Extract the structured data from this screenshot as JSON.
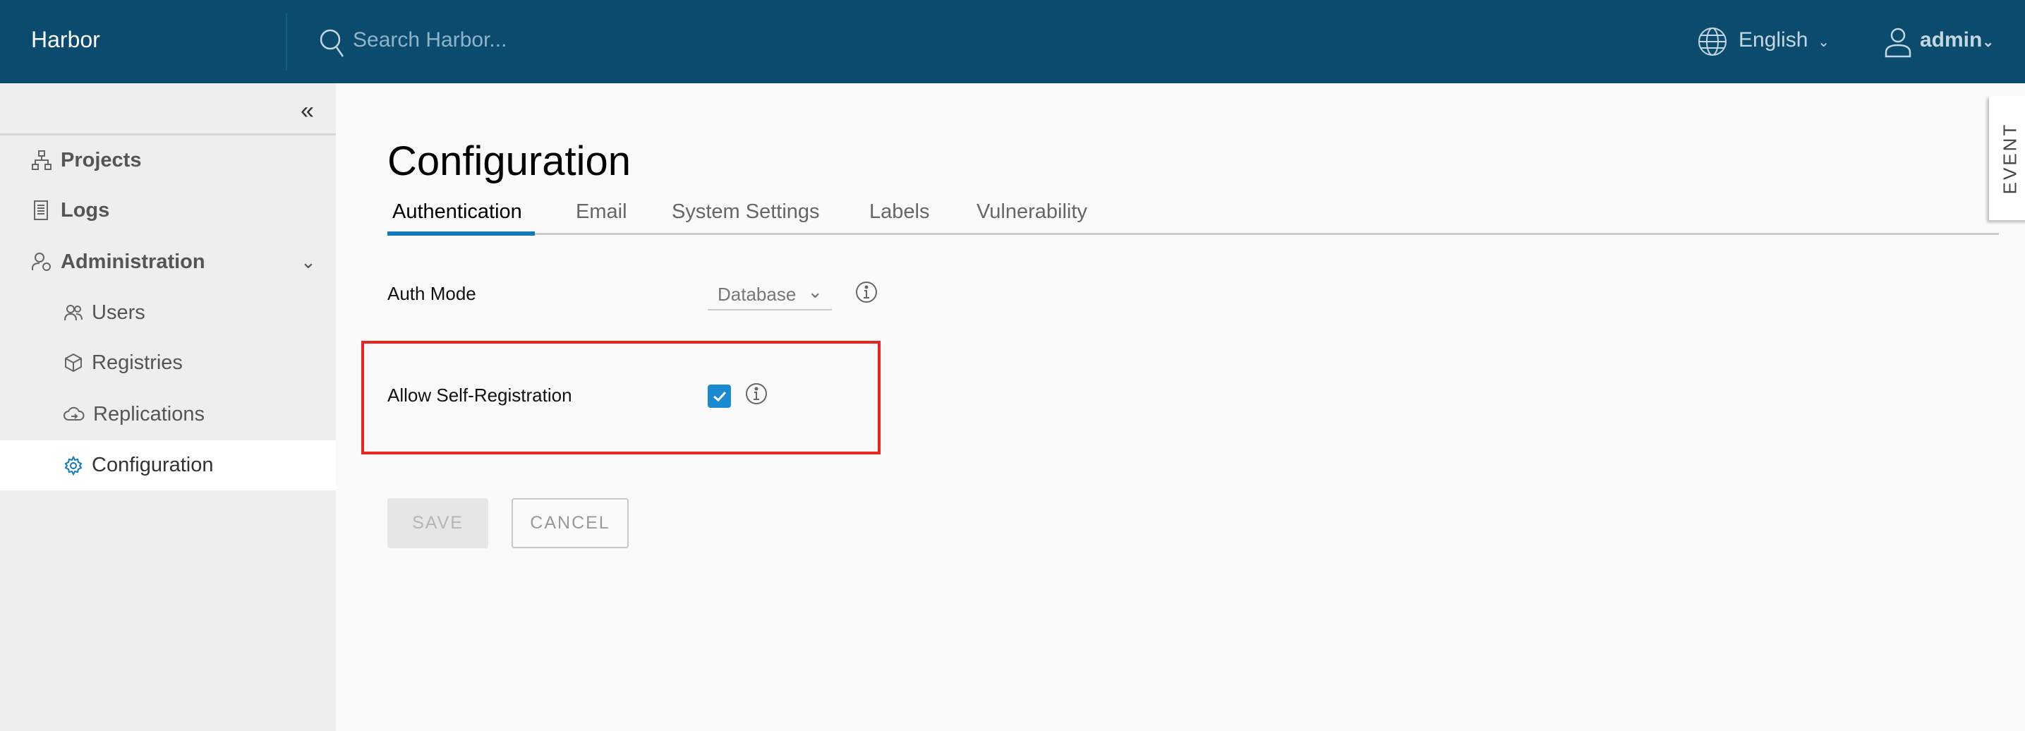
{
  "header": {
    "brand": "Harbor",
    "search_placeholder": "Search Harbor...",
    "language": "English",
    "user": "admin"
  },
  "sidebar": {
    "items": [
      {
        "label": "Projects",
        "icon": "projects-icon"
      },
      {
        "label": "Logs",
        "icon": "logs-icon"
      },
      {
        "label": "Administration",
        "icon": "administration-icon"
      },
      {
        "label": "Users",
        "icon": "users-icon"
      },
      {
        "label": "Registries",
        "icon": "registries-icon"
      },
      {
        "label": "Replications",
        "icon": "replications-icon"
      },
      {
        "label": "Configuration",
        "icon": "gear-icon",
        "active": true
      }
    ]
  },
  "main": {
    "title": "Configuration",
    "tabs": [
      {
        "label": "Authentication",
        "active": true
      },
      {
        "label": "Email"
      },
      {
        "label": "System Settings"
      },
      {
        "label": "Labels"
      },
      {
        "label": "Vulnerability"
      }
    ],
    "auth_mode": {
      "label": "Auth Mode",
      "value": "Database"
    },
    "self_registration": {
      "label": "Allow Self-Registration",
      "checked": true
    },
    "save_label": "SAVE",
    "cancel_label": "CANCEL"
  },
  "event_tab": "EVENT",
  "colors": {
    "header": "#0a4b6e",
    "accent": "#1479b8",
    "highlight": "#e8251f"
  }
}
